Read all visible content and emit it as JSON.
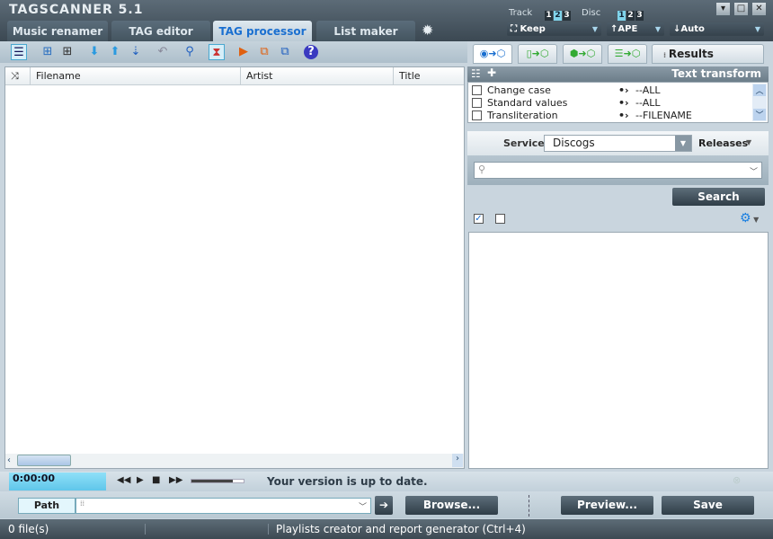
{
  "app": {
    "title": "TAGSCANNER 5.1"
  },
  "tabs": [
    {
      "label": "Music renamer"
    },
    {
      "label": "TAG editor"
    },
    {
      "label": "TAG processor"
    },
    {
      "label": "List maker"
    }
  ],
  "active_tab": "TAG processor",
  "header": {
    "track_label": "Track",
    "disc_label": "Disc",
    "track_numbers": [
      "1",
      "2",
      "3"
    ],
    "track_selected": "2",
    "disc_numbers": [
      "1",
      "2",
      "3"
    ],
    "disc_selected": "1",
    "dropdowns": {
      "keep": "Keep",
      "ape": "APE",
      "auto": "Auto"
    }
  },
  "table": {
    "columns": [
      "Filename",
      "Artist",
      "Title"
    ],
    "rows": []
  },
  "right_tabs": {
    "results_label": "Results"
  },
  "text_transform": {
    "title": "Text transform",
    "items": [
      {
        "label": "Change case",
        "value": "--ALL",
        "checked": false
      },
      {
        "label": "Standard values",
        "value": "--ALL",
        "checked": false
      },
      {
        "label": "Transliteration",
        "value": "--FILENAME",
        "checked": false
      }
    ]
  },
  "service": {
    "label": "Service",
    "value": "Discogs",
    "mode": "Releases",
    "search_placeholder": "",
    "search_button": "Search"
  },
  "player": {
    "time": "0:00:00",
    "volume": 0.8,
    "message": "Your version is up to date."
  },
  "pathbar": {
    "path_label": "Path",
    "path_value": "",
    "browse": "Browse...",
    "preview": "Preview...",
    "save": "Save"
  },
  "status": {
    "files": "0 file(s)",
    "hint": "Playlists creator and report generator (Ctrl+4)"
  }
}
